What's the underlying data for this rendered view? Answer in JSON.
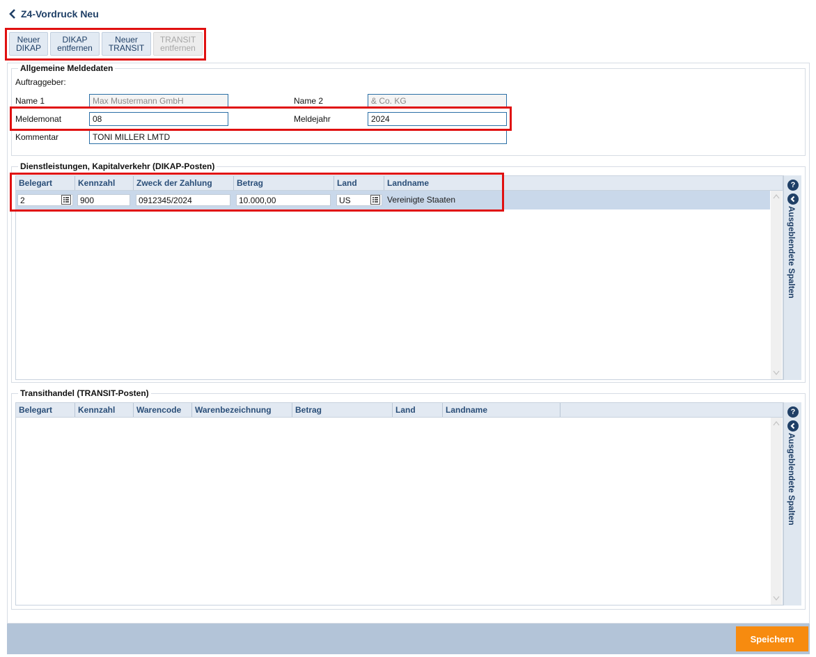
{
  "header": {
    "title": "Z4-Vordruck Neu"
  },
  "toolbar": {
    "buttons": [
      {
        "line1": "Neuer",
        "line2": "DIKAP"
      },
      {
        "line1": "DIKAP",
        "line2": "entfernen"
      },
      {
        "line1": "Neuer",
        "line2": "TRANSIT"
      },
      {
        "line1": "TRANSIT",
        "line2": "entfernen"
      }
    ]
  },
  "meldedaten": {
    "legend": "Allgemeine Meldedaten",
    "auftraggeber_label": "Auftraggeber:",
    "name1_label": "Name 1",
    "name1_value": "Max Mustermann GmbH",
    "name2_label": "Name 2",
    "name2_value": "& Co. KG",
    "meldemonat_label": "Meldemonat",
    "meldemonat_value": "08",
    "meldejahr_label": "Meldejahr",
    "meldejahr_value": "2024",
    "kommentar_label": "Kommentar",
    "kommentar_value": "TONI MILLER LMTD"
  },
  "dikap": {
    "legend": "Dienstleistungen, Kapitalverkehr (DIKAP-Posten)",
    "columns": [
      "Belegart",
      "Kennzahl",
      "Zweck der Zahlung",
      "Betrag",
      "Land",
      "Landname"
    ],
    "row": {
      "belegart": "2",
      "kennzahl": "900",
      "zweck": "0912345/2024",
      "betrag": "10.000,00",
      "land": "US",
      "landname": "Vereinigte Staaten"
    },
    "side_label": "Ausgeblendete Spalten"
  },
  "transit": {
    "legend": "Transithandel (TRANSIT-Posten)",
    "columns": [
      "Belegart",
      "Kennzahl",
      "Warencode",
      "Warenbezeichnung",
      "Betrag",
      "Land",
      "Landname"
    ],
    "side_label": "Ausgeblendete Spalten"
  },
  "footer": {
    "save_label": "Speichern"
  },
  "colors": {
    "accent": "#f78b0f",
    "highlight": "#e01010",
    "header_text": "#1f3f66"
  }
}
